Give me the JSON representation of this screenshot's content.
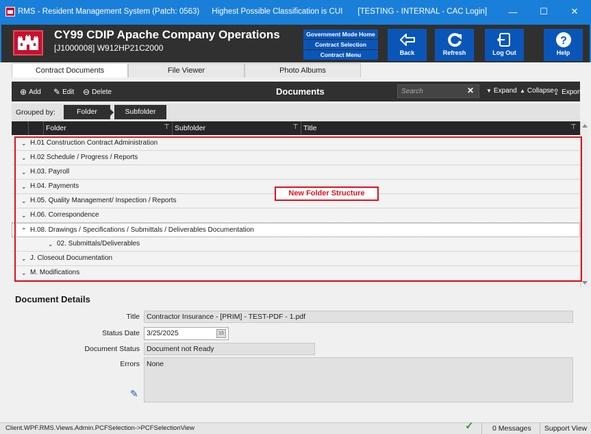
{
  "window": {
    "title": "RMS - Resident Management System (Patch: 0563)",
    "classification": "Highest Possible Classification is CUI",
    "environment": "[TESTING - INTERNAL - CAC Login]",
    "minimize": "—",
    "maximize": "☐",
    "close": "✕"
  },
  "header": {
    "title": "CY99 CDIP Apache Company Operations",
    "contract_id": "[J1000008] W912HP21C2000",
    "gov_menu": [
      "Government Mode Home",
      "Contract Selection",
      "Contract Menu"
    ],
    "buttons": [
      {
        "label": "Back",
        "icon": "back-arrow-icon"
      },
      {
        "label": "Refresh",
        "icon": "refresh-icon"
      },
      {
        "label": "Log Out",
        "icon": "logout-icon"
      },
      {
        "label": "Help",
        "icon": "help-icon"
      }
    ]
  },
  "tabs": [
    {
      "label": "Contract Documents",
      "active": true
    },
    {
      "label": "File Viewer",
      "active": false
    },
    {
      "label": "Photo Albums",
      "active": false
    }
  ],
  "toolbar": {
    "add": "Add",
    "edit": "Edit",
    "delete": "Delete",
    "title": "Documents",
    "search_placeholder": "Search",
    "expand": "Expand",
    "collapse": "Collapse",
    "export": "Export"
  },
  "grouping": {
    "label": "Grouped by:",
    "groups": [
      "Folder",
      "Subfolder"
    ]
  },
  "grid": {
    "columns": [
      "Folder",
      "Subfolder",
      "Title"
    ],
    "rows": [
      {
        "level": 0,
        "expanded": false,
        "label": "H.01 Construction Contract Administration"
      },
      {
        "level": 0,
        "expanded": false,
        "label": "H.02 Schedule / Progress / Reports"
      },
      {
        "level": 0,
        "expanded": false,
        "label": "H.03. Payroll"
      },
      {
        "level": 0,
        "expanded": false,
        "label": "H.04. Payments"
      },
      {
        "level": 0,
        "expanded": false,
        "label": "H.05. Quality Management/ Inspection / Reports"
      },
      {
        "level": 0,
        "expanded": false,
        "label": "H.06. Correspondence"
      },
      {
        "level": 0,
        "expanded": true,
        "selected": true,
        "label": "H.08. Drawings / Specifications / Submittals / Deliverables Documentation"
      },
      {
        "level": 1,
        "expanded": false,
        "label": "02. Submittals/Deliverables"
      },
      {
        "level": 0,
        "expanded": false,
        "label": "J. Closeout Documentation"
      },
      {
        "level": 0,
        "expanded": false,
        "label": "M. Modifications"
      }
    ]
  },
  "annotation": {
    "text": "New Folder Structure",
    "color": "#e0101a"
  },
  "details": {
    "heading": "Document Details",
    "title_label": "Title",
    "title_value": "Contractor Insurance - [PRIM] - TEST-PDF - 1.pdf",
    "status_date_label": "Status Date",
    "status_date_value": "3/25/2025",
    "calendar_day": "15",
    "document_status_label": "Document Status",
    "document_status_value": "Document not Ready",
    "errors_label": "Errors",
    "errors_value": "None"
  },
  "statusbar": {
    "path": "Client.WPF.RMS.Views.Admin.PCFSelection->PCFSelectionView",
    "messages": "0 Messages",
    "support": "Support View"
  },
  "colors": {
    "titlebar": "#1a7fd9",
    "header_bg": "#303030",
    "button_blue": "#0a56b8",
    "logo_red": "#c8102e"
  }
}
